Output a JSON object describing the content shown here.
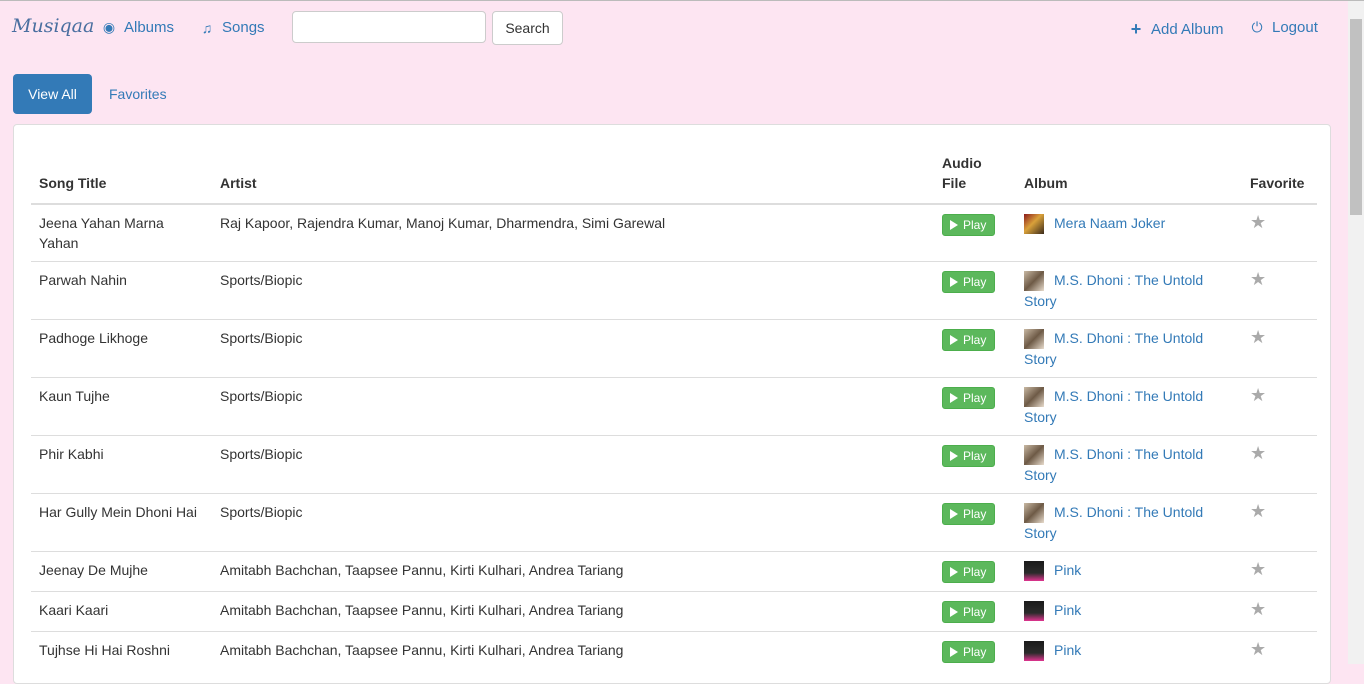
{
  "navbar": {
    "brand": "Musiqaa",
    "albums_label": "Albums",
    "songs_label": "Songs",
    "search_value": "",
    "search_button": "Search",
    "add_album_label": "Add Album",
    "logout_label": "Logout"
  },
  "tabs": {
    "view_all": "View All",
    "favorites": "Favorites"
  },
  "table": {
    "headers": {
      "title": "Song Title",
      "artist": "Artist",
      "audio_line1": "Audio",
      "audio_line2": "File",
      "album": "Album",
      "favorite": "Favorite"
    },
    "play_label": "Play",
    "rows": [
      {
        "title": "Jeena Yahan Marna Yahan",
        "artist": "Raj Kapoor, Rajendra Kumar, Manoj Kumar, Dharmendra, Simi Garewal",
        "album": "Mera Naam Joker"
      },
      {
        "title": "Parwah Nahin",
        "artist": "Sports/Biopic",
        "album": "M.S. Dhoni : The Untold Story"
      },
      {
        "title": "Padhoge Likhoge",
        "artist": "Sports/Biopic",
        "album": "M.S. Dhoni : The Untold Story"
      },
      {
        "title": "Kaun Tujhe",
        "artist": "Sports/Biopic",
        "album": "M.S. Dhoni : The Untold Story"
      },
      {
        "title": "Phir Kabhi",
        "artist": "Sports/Biopic",
        "album": "M.S. Dhoni : The Untold Story"
      },
      {
        "title": "Har Gully Mein Dhoni Hai",
        "artist": "Sports/Biopic",
        "album": "M.S. Dhoni : The Untold Story"
      },
      {
        "title": "Jeenay De Mujhe",
        "artist": "Amitabh Bachchan, Taapsee Pannu, Kirti Kulhari, Andrea Tariang",
        "album": "Pink"
      },
      {
        "title": "Kaari Kaari",
        "artist": "Amitabh Bachchan, Taapsee Pannu, Kirti Kulhari, Andrea Tariang",
        "album": "Pink"
      },
      {
        "title": "Tujhse Hi Hai Roshni",
        "artist": "Amitabh Bachchan, Taapsee Pannu, Kirti Kulhari, Andrea Tariang",
        "album": "Pink"
      }
    ]
  },
  "icons": {
    "albums": "disc-icon",
    "songs": "music-note-icon",
    "add_album": "plus-icon",
    "logout": "power-icon",
    "play": "play-icon",
    "favorite": "star-icon"
  },
  "colors": {
    "background": "#fde5f2",
    "link": "#337ab7",
    "primary": "#337ab7",
    "play_button": "#5cb85c",
    "star": "#aaaaaa"
  }
}
